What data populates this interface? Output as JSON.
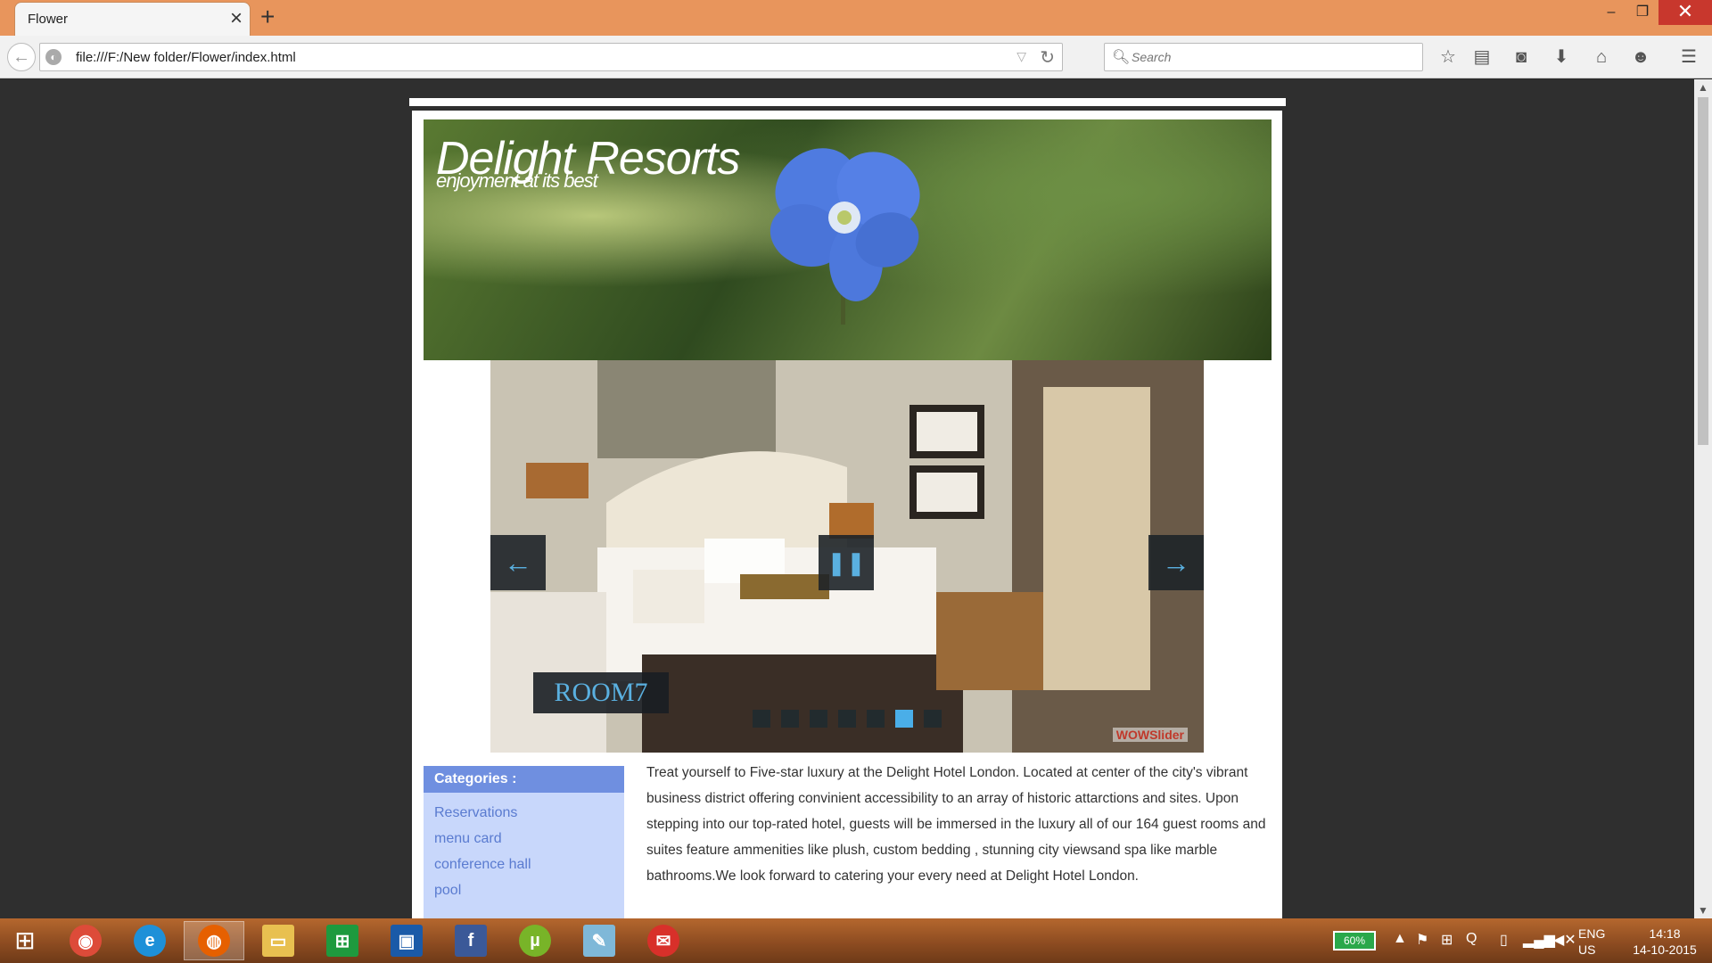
{
  "browser": {
    "tab_title": "Flower",
    "tab_close": "×",
    "new_tab": "+",
    "url": "file:///F:/New folder/Flower/index.html",
    "search_placeholder": "Search",
    "window_controls": {
      "minimize": "–",
      "maximize": "❐",
      "close": "✕"
    }
  },
  "toolbar_icons": [
    "bookmark-star-icon",
    "reading-list-icon",
    "pocket-icon",
    "download-icon",
    "home-icon",
    "chat-icon",
    "menu-icon"
  ],
  "page": {
    "header": {
      "title": "Delight Resorts",
      "subtitle": "enjoyment at its best"
    },
    "slider": {
      "caption": "ROOM7",
      "bullet_count": 7,
      "active_bullet": 6,
      "watermark": "WOWSlider"
    },
    "categories": {
      "title": "Categories :",
      "items": [
        "Reservations",
        "menu card",
        "conference hall",
        "pool"
      ]
    },
    "description": "Treat yourself to Five-star luxury at the Delight Hotel London. Located at center of the city's vibrant business district offering convinient accessibility to an array of historic attarctions and sites. Upon stepping into our top-rated hotel, guests will be immersed in the luxury all of our 164 guest rooms and suites feature ammenities like plush, custom bedding , stunning city viewsand spa like marble bathrooms.We look forward to catering your every need at Delight Hotel London."
  },
  "taskbar": {
    "apps": [
      "chrome",
      "internet-explorer",
      "firefox",
      "file-explorer",
      "store",
      "lenovo",
      "facebook",
      "utorrent",
      "notepad",
      "mail"
    ],
    "battery": "60%",
    "lang": "ENG",
    "region": "US",
    "time": "14:18",
    "date": "14-10-2015"
  },
  "colors": {
    "titlebar": "#e8955c",
    "category_header": "#6f8fe0",
    "category_bg": "#c8d7fb",
    "slider_accent": "#4aaee8"
  }
}
